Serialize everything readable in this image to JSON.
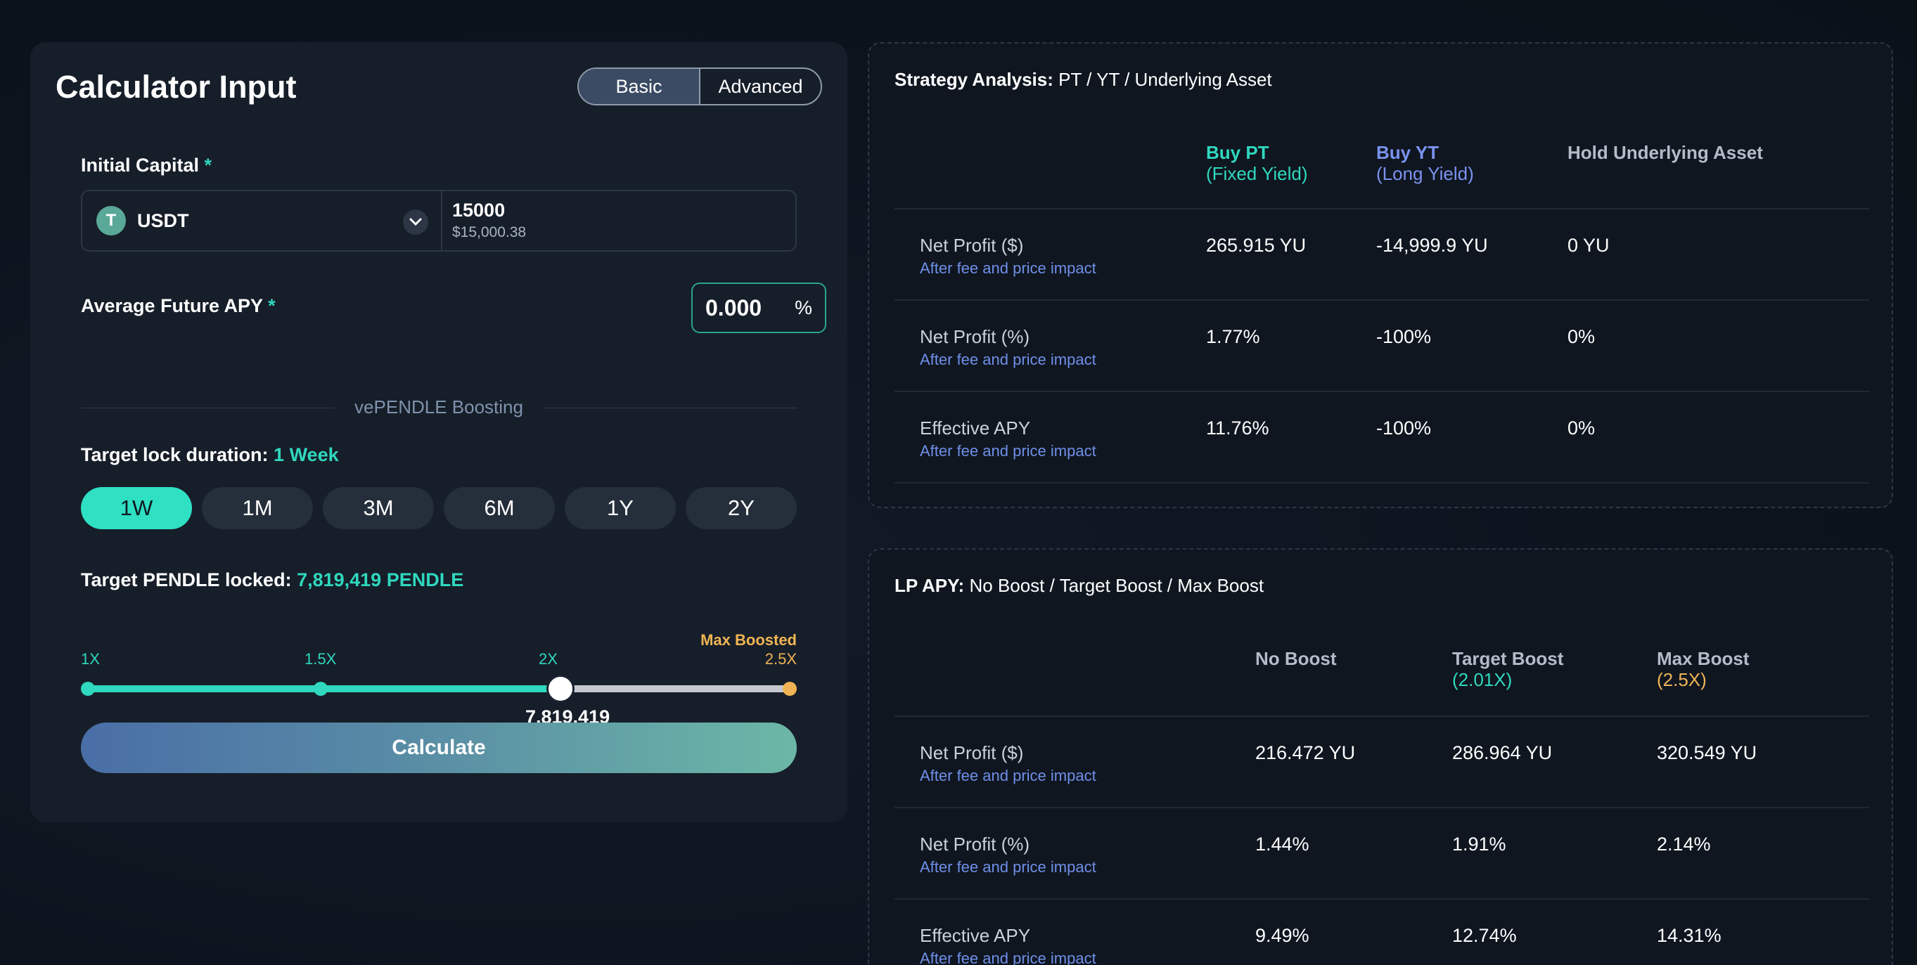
{
  "calculator": {
    "title": "Calculator Input",
    "mode_basic": "Basic",
    "mode_advanced": "Advanced",
    "initial_capital_label": "Initial Capital",
    "required_mark": "*",
    "token_icon_letter": "T",
    "token_name": "USDT",
    "amount_value": "15000",
    "amount_usd": "$15,000.38",
    "apy_label": "Average Future APY",
    "apy_value": "0.000",
    "apy_unit": "%",
    "boosting_divider": "vePENDLE Boosting",
    "lock_duration_label": "Target lock duration:",
    "lock_duration_value": "1 Week",
    "durations": [
      "1W",
      "1M",
      "3M",
      "6M",
      "1Y",
      "2Y"
    ],
    "active_duration": "1W",
    "pendle_locked_label": "Target PENDLE locked:",
    "pendle_locked_value": "7,819,419 PENDLE",
    "slider": {
      "ticks": [
        "1X",
        "1.5X",
        "2X"
      ],
      "max_boost_label": "Max Boosted",
      "max_value_label": "2.5X",
      "current_value": "7,819,419",
      "min": 1,
      "max": 2.5,
      "current": 2.01
    },
    "calculate_label": "Calculate"
  },
  "strategy": {
    "title_bold": "Strategy Analysis:",
    "title_rest": "PT / YT / Underlying Asset",
    "columns": [
      {
        "label": "Buy PT",
        "sub": "(Fixed Yield)"
      },
      {
        "label": "Buy YT",
        "sub": "(Long Yield)"
      },
      {
        "label": "Hold Underlying Asset",
        "sub": ""
      }
    ],
    "rows": [
      {
        "label": "Net Profit ($)",
        "sub": "After fee and price impact",
        "values": [
          "265.915 YU",
          "-14,999.9 YU",
          "0 YU"
        ]
      },
      {
        "label": "Net Profit (%)",
        "sub": "After fee and price impact",
        "values": [
          "1.77%",
          "-100%",
          "0%"
        ]
      },
      {
        "label": "Effective APY",
        "sub": "After fee and price impact",
        "values": [
          "11.76%",
          "-100%",
          "0%"
        ]
      }
    ]
  },
  "lp": {
    "title_bold": "LP APY:",
    "title_rest": "No Boost / Target Boost / Max Boost",
    "columns": [
      {
        "label": "No Boost",
        "sub": ""
      },
      {
        "label": "Target Boost",
        "sub": "(2.01X)"
      },
      {
        "label": "Max Boost",
        "sub": "(2.5X)"
      }
    ],
    "rows": [
      {
        "label": "Net Profit ($)",
        "sub": "After fee and price impact",
        "values": [
          "216.472 YU",
          "286.964 YU",
          "320.549 YU"
        ]
      },
      {
        "label": "Net Profit (%)",
        "sub": "After fee and price impact",
        "values": [
          "1.44%",
          "1.91%",
          "2.14%"
        ]
      },
      {
        "label": "Effective APY",
        "sub": "After fee and price impact",
        "values": [
          "9.49%",
          "12.74%",
          "14.31%"
        ]
      }
    ]
  }
}
